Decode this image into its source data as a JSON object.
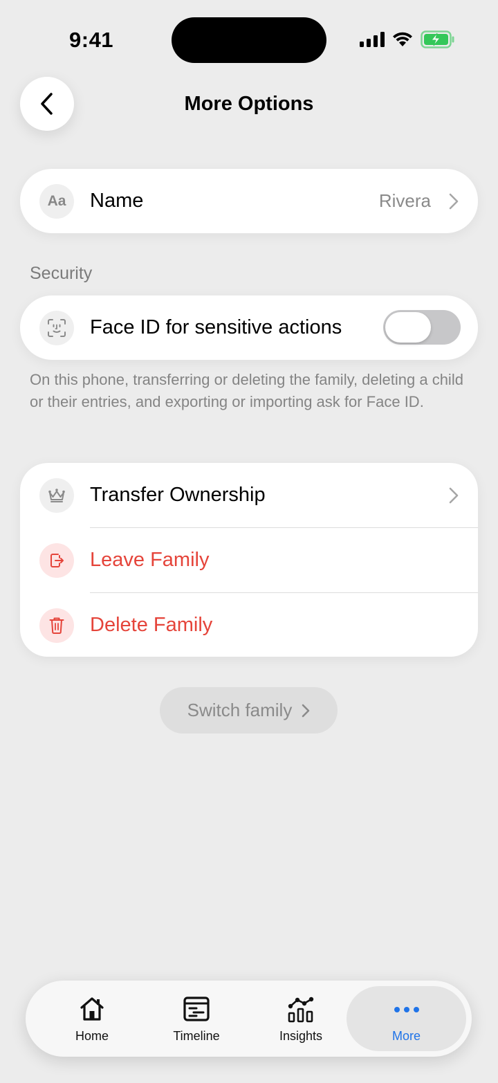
{
  "status_bar": {
    "time": "9:41"
  },
  "header": {
    "title": "More Options"
  },
  "name_row": {
    "icon_text": "Aa",
    "label": "Name",
    "value": "Rivera"
  },
  "security": {
    "section_label": "Security",
    "face_id_label": "Face ID for sensitive actions",
    "face_id_enabled": false,
    "footnote": "On this phone, transferring or deleting the family, deleting a child or their entries, and exporting or importing ask for Face ID."
  },
  "actions": {
    "transfer_label": "Transfer Ownership",
    "leave_label": "Leave Family",
    "delete_label": "Delete Family"
  },
  "switch_family": {
    "label": "Switch family"
  },
  "tab_bar": {
    "tabs": [
      {
        "label": "Home",
        "icon": "home-icon"
      },
      {
        "label": "Timeline",
        "icon": "timeline-icon"
      },
      {
        "label": "Insights",
        "icon": "insights-icon"
      },
      {
        "label": "More",
        "icon": "more-icon"
      }
    ],
    "active": "More"
  },
  "colors": {
    "background": "#ececec",
    "danger": "#e5443a",
    "accent": "#1f73e8",
    "battery": "#34c759"
  }
}
